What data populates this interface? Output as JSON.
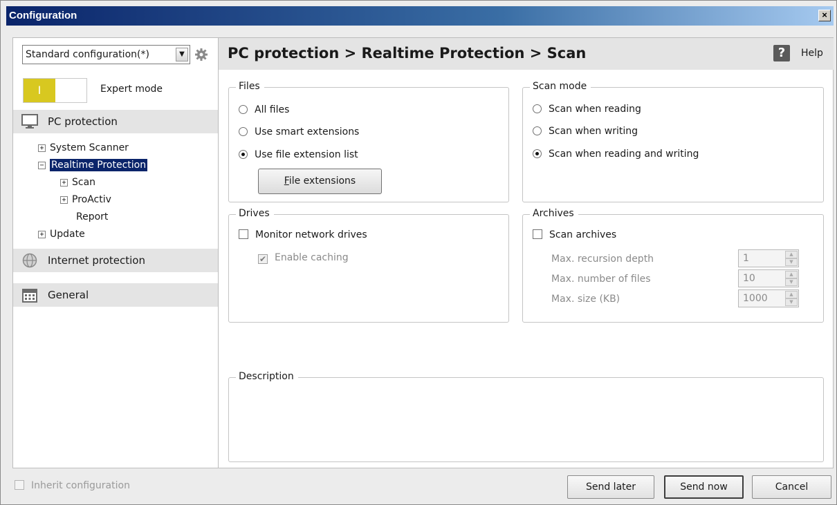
{
  "window": {
    "title": "Configuration",
    "close_label": "×"
  },
  "left": {
    "config_select": {
      "value": "Standard configuration(*)"
    },
    "expert_mode_label": "Expert mode",
    "toggle_label": "I",
    "sections": [
      {
        "label": "PC protection",
        "icon": "monitor-icon"
      },
      {
        "label": "Internet protection",
        "icon": "globe-icon"
      },
      {
        "label": "General",
        "icon": "calendar-icon"
      }
    ],
    "tree": {
      "system_scanner": "System Scanner",
      "realtime_protection": "Realtime Protection",
      "scan": "Scan",
      "proactiv": "ProActiv",
      "report": "Report",
      "update": "Update"
    },
    "expander_collapsed": "+",
    "expander_expanded": "−"
  },
  "main": {
    "title": "PC protection > Realtime Protection > Scan",
    "help_label": "Help",
    "help_icon_glyph": "?",
    "files": {
      "title": "Files",
      "options": [
        "All files",
        "Use smart extensions",
        "Use file extension list"
      ],
      "selected": 2,
      "button_prefix": "F",
      "button_rest": "ile extensions"
    },
    "scan_mode": {
      "title": "Scan mode",
      "options": [
        "Scan when reading",
        "Scan when writing",
        "Scan when reading and writing"
      ],
      "selected": 2
    },
    "drives": {
      "title": "Drives",
      "monitor_label": "Monitor network drives",
      "monitor_checked": false,
      "caching_label": "Enable caching",
      "caching_checked": true
    },
    "archives": {
      "title": "Archives",
      "scan_label": "Scan archives",
      "scan_checked": false,
      "fields": [
        {
          "label": "Max. recursion depth",
          "value": "1"
        },
        {
          "label": "Max. number of files",
          "value": "10"
        },
        {
          "label": "Max. size (KB)",
          "value": "1000"
        }
      ]
    },
    "description": {
      "title": "Description",
      "text": ""
    }
  },
  "footer": {
    "inherit_label": "Inherit configuration",
    "send_later": "Send later",
    "send_now": "Send now",
    "cancel": "Cancel"
  },
  "colors": {
    "accent_selected": "#0a246a",
    "toggle_on": "#d8c820"
  }
}
